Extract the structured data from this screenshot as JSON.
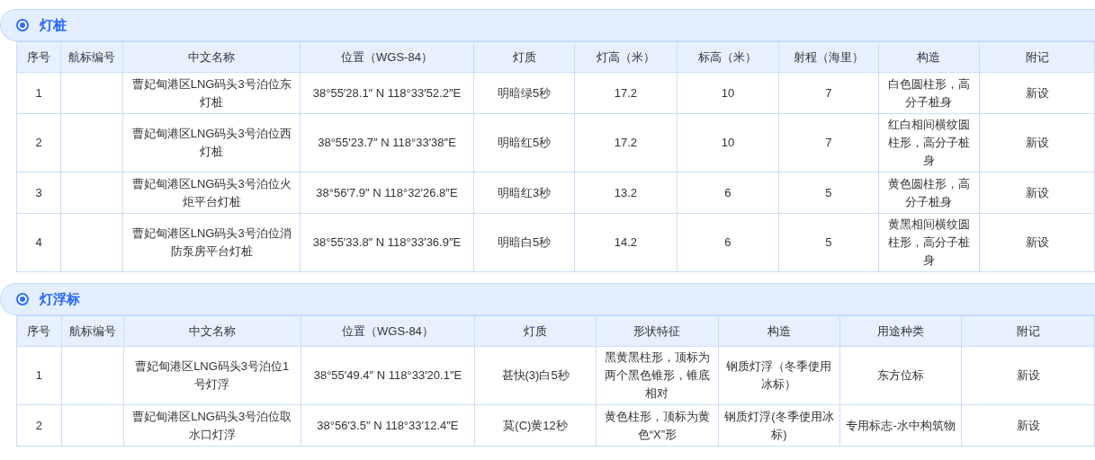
{
  "sections": [
    {
      "title": "灯桩",
      "selected": true,
      "columns": [
        "序号",
        "航标编号",
        "中文名称",
        "位置（WGS-84）",
        "灯质",
        "灯高（米）",
        "标高（米）",
        "射程（海里）",
        "构造",
        "附记"
      ],
      "rows": [
        [
          "1",
          null,
          "曹妃甸港区LNG码头3号泊位东灯桩",
          "38°55′28.1″ N 118°33′52.2″E",
          "明暗绿5秒",
          "17.2",
          "10",
          "7",
          "白色圆柱形，高分子桩身",
          "新设"
        ],
        [
          "2",
          null,
          "曹妃甸港区LNG码头3号泊位西灯桩",
          "38°55′23.7″ N 118°33′38″E",
          "明暗红5秒",
          "17.2",
          "10",
          "7",
          "红白相间横纹圆柱形，高分子桩身",
          "新设"
        ],
        [
          "3",
          null,
          "曹妃甸港区LNG码头3号泊位火炬平台灯桩",
          "38°56′7.9″ N 118°32′26.8″E",
          "明暗红3秒",
          "13.2",
          "6",
          "5",
          "黄色圆柱形，高分子桩身",
          "新设"
        ],
        [
          "4",
          null,
          "曹妃甸港区LNG码头3号泊位消防泵房平台灯桩",
          "38°55′33.8″ N 118°33′36.9″E",
          "明暗白5秒",
          "14.2",
          "6",
          "5",
          "黄黑相间横纹圆柱形，高分子桩身",
          "新设"
        ]
      ]
    },
    {
      "title": "灯浮标",
      "selected": true,
      "columns": [
        "序号",
        "航标编号",
        "中文名称",
        "位置（WGS-84）",
        "灯质",
        "形状特征",
        "构造",
        "用途种类",
        "附记"
      ],
      "rows": [
        [
          "1",
          null,
          "曹妃甸港区LNG码头3号泊位1号灯浮",
          "38°55′49.4″ N 118°33′20.1″E",
          "甚快(3)白5秒",
          "黑黄黑柱形，顶标为两个黑色锥形，锥底相对",
          "钢质灯浮（冬季使用冰标）",
          "东方位标",
          "新设"
        ],
        [
          "2",
          null,
          "曹妃甸港区LNG码头3号泊位取水口灯浮",
          "38°56′3.5″ N 118°33′12.4″E",
          "莫(C)黄12秒",
          "黄色柱形，顶标为黄色“X”形",
          "钢质灯浮(冬季使用冰标)",
          "专用标志-水中构筑物",
          "新设"
        ]
      ]
    }
  ]
}
